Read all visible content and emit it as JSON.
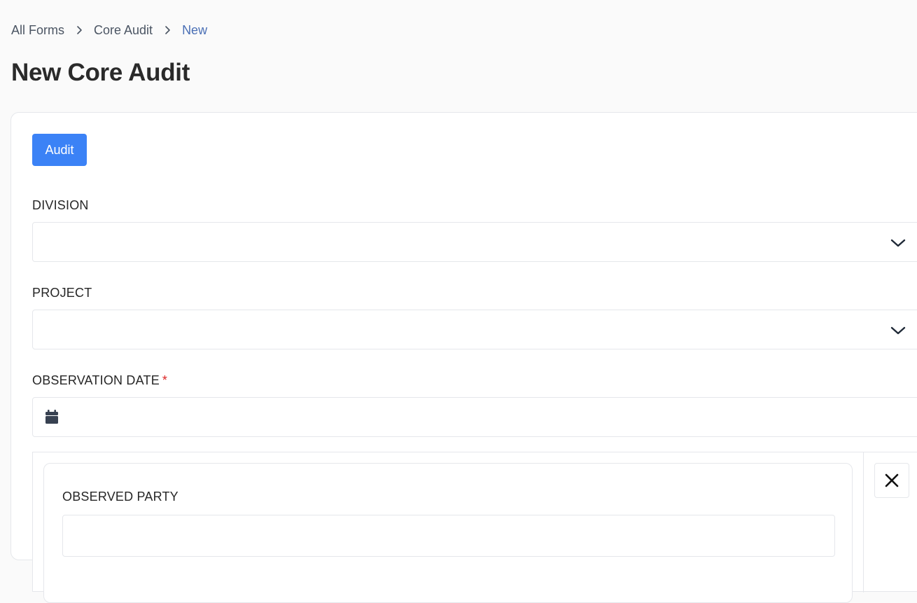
{
  "breadcrumb": {
    "items": [
      {
        "label": "All Forms"
      },
      {
        "label": "Core Audit"
      },
      {
        "label": "New"
      }
    ]
  },
  "page": {
    "title": "New Core Audit"
  },
  "form": {
    "section_button_label": "Audit",
    "fields": {
      "division": {
        "label": "DIVISION",
        "value": ""
      },
      "project": {
        "label": "PROJECT",
        "value": ""
      },
      "observation_date": {
        "label": "OBSERVATION DATE",
        "required_marker": "*",
        "value": ""
      },
      "observed_party": {
        "label": "OBSERVED PARTY",
        "value": ""
      }
    }
  },
  "icons": {
    "breadcrumb_separator": "chevron-right-icon",
    "select_toggle": "chevron-down-icon",
    "date": "calendar-icon",
    "remove": "close-icon"
  },
  "colors": {
    "accent": "#3b82f6",
    "breadcrumb_current": "#4a6fb5",
    "required": "#dc2626",
    "page_background": "#fafafa"
  }
}
